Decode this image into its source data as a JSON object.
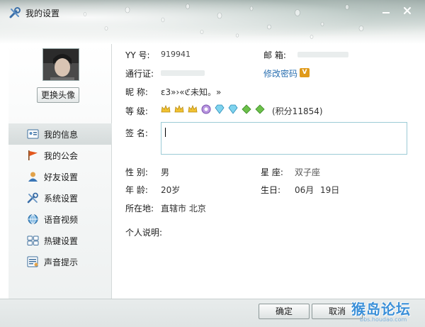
{
  "window": {
    "title": "我的设置"
  },
  "sidebar": {
    "change_avatar": "更换头像",
    "items": [
      {
        "label": "我的信息",
        "icon": "id-card-icon",
        "active": true
      },
      {
        "label": "我的公会",
        "icon": "flag-icon",
        "active": false
      },
      {
        "label": "好友设置",
        "icon": "user-icon",
        "active": false
      },
      {
        "label": "系统设置",
        "icon": "tools-icon",
        "active": false
      },
      {
        "label": "语音视频",
        "icon": "globe-icon",
        "active": false
      },
      {
        "label": "热键设置",
        "icon": "keyboard-icon",
        "active": false
      },
      {
        "label": "声音提示",
        "icon": "sound-note-icon",
        "active": false
      }
    ]
  },
  "profile": {
    "yy_label": "YY 号:",
    "yy_value": "919941",
    "email_label": "邮   箱:",
    "passport_label": "通行证:",
    "change_password": "修改密码",
    "nickname_label": "昵   称:",
    "nickname_value": "ε3»›«ℭ未知。»",
    "level_label": "等   级:",
    "points_text": "(积分11854)",
    "signature_label": "签   名:",
    "signature_value": "",
    "gender_label": "性   别:",
    "gender_value": "男",
    "zodiac_label": "星   座:",
    "zodiac_value": "双子座",
    "age_label": "年   龄:",
    "age_value": "20岁",
    "birthday_label": "生日:",
    "birthday_month": "06月",
    "birthday_day": "19日",
    "location_label": "所在地:",
    "location_value": "直辖市  北京",
    "description_label": "个人说明:"
  },
  "footer": {
    "ok": "确定",
    "cancel": "取消"
  },
  "watermark": {
    "text": "猴岛论坛",
    "sub": "bbs.houdao.com"
  },
  "colors": {
    "link": "#2a6fb0",
    "sig_border": "#9ccbd6",
    "active_nav": "#d5dbdb"
  }
}
